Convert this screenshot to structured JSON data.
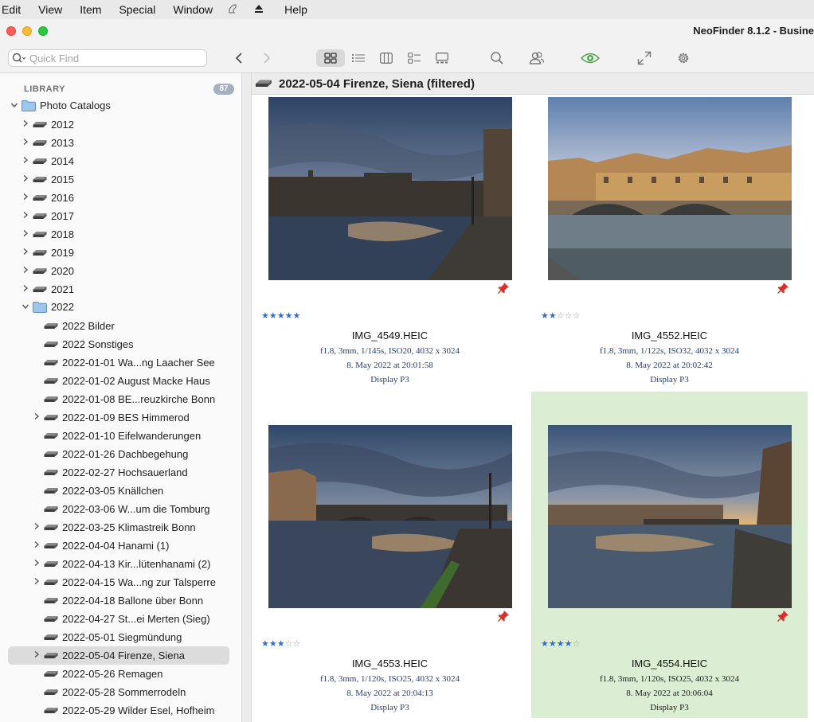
{
  "menubar": [
    "Edit",
    "View",
    "Item",
    "Special",
    "Window",
    "Help"
  ],
  "window": {
    "title": "NeoFinder 8.1.2 - Busine"
  },
  "search": {
    "placeholder": "Quick Find"
  },
  "sidebar": {
    "header": "LIBRARY",
    "count": "87",
    "root": "Photo Catalogs",
    "years": [
      "2012",
      "2013",
      "2014",
      "2015",
      "2016",
      "2017",
      "2018",
      "2019",
      "2020",
      "2021"
    ],
    "open_year": "2022",
    "items": [
      {
        "label": "2022 Bilder",
        "expandable": false
      },
      {
        "label": "2022 Sonstiges",
        "expandable": false
      },
      {
        "label": "2022-01-01 Wa...ng Laacher See",
        "expandable": false
      },
      {
        "label": "2022-01-02 August Macke Haus",
        "expandable": false
      },
      {
        "label": "2022-01-08 BE...reuzkirche Bonn",
        "expandable": false
      },
      {
        "label": "2022-01-09 BES Himmerod",
        "expandable": true
      },
      {
        "label": "2022-01-10 Eifelwanderungen",
        "expandable": false
      },
      {
        "label": "2022-01-26 Dachbegehung",
        "expandable": false
      },
      {
        "label": "2022-02-27 Hochsauerland",
        "expandable": false
      },
      {
        "label": "2022-03-05 Knällchen",
        "expandable": false
      },
      {
        "label": "2022-03-06 W...um die Tomburg",
        "expandable": false
      },
      {
        "label": "2022-03-25 Klimastreik Bonn",
        "expandable": true
      },
      {
        "label": "2022-04-04 Hanami (1)",
        "expandable": true
      },
      {
        "label": "2022-04-13 Kir...lütenhanami (2)",
        "expandable": true
      },
      {
        "label": "2022-04-15 Wa...ng zur Talsperre",
        "expandable": true
      },
      {
        "label": "2022-04-18 Ballone über Bonn",
        "expandable": false
      },
      {
        "label": "2022-04-27 St...ei Merten (Sieg)",
        "expandable": false
      },
      {
        "label": "2022-05-01 Siegmündung",
        "expandable": false
      },
      {
        "label": "2022-05-04 Firenze, Siena",
        "expandable": true,
        "selected": true
      },
      {
        "label": "2022-05-26 Remagen",
        "expandable": false
      },
      {
        "label": "2022-05-28 Sommerrodeln",
        "expandable": false
      },
      {
        "label": "2022-05-29 Wilder Esel, Hofheim",
        "expandable": false
      }
    ]
  },
  "content": {
    "title": "2022-05-04 Firenze, Siena  (filtered)",
    "photos": [
      {
        "file": "IMG_4549.HEIC",
        "exif": "f1.8, 3mm, 1/145s, ISO20, 4032 x 3024",
        "date": "8. May 2022 at 20:01:58",
        "profile": "Display P3",
        "rating": 5,
        "selected": false
      },
      {
        "file": "IMG_4552.HEIC",
        "exif": "f1.8, 3mm, 1/122s, ISO32, 4032 x 3024",
        "date": "8. May 2022 at 20:02:42",
        "profile": "Display P3",
        "rating": 2,
        "selected": false
      },
      {
        "file": "IMG_4553.HEIC",
        "exif": "f1.8, 3mm, 1/120s, ISO25, 4032 x 3024",
        "date": "8. May 2022 at 20:04:13",
        "profile": "Display P3",
        "rating": 3,
        "selected": false
      },
      {
        "file": "IMG_4554.HEIC",
        "exif": "f1.8, 3mm, 1/120s, ISO25, 4032 x 3024",
        "date": "8. May 2022 at 20:06:04",
        "profile": "Display P3",
        "rating": 4,
        "selected": true
      }
    ]
  },
  "colors": {
    "accent": "#2f6fd4",
    "selection_green": "#dbeed3",
    "pin": "#d8312a"
  }
}
